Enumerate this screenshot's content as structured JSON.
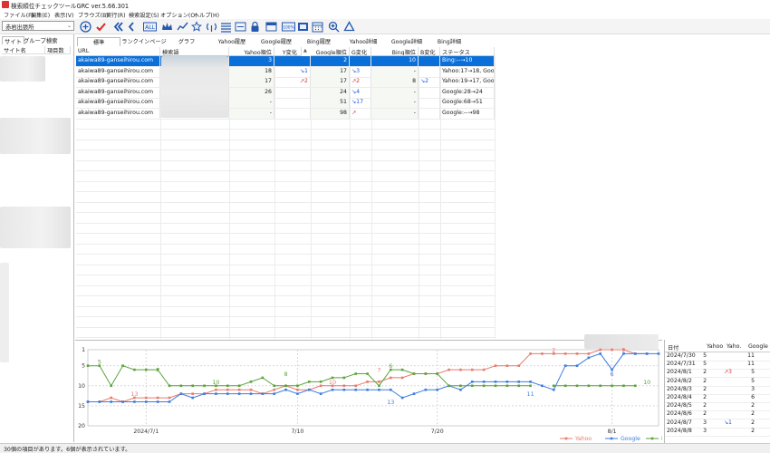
{
  "window": {
    "title": "検索順位チェックツールGRC  ver.5.66.301"
  },
  "menu": [
    "ファイル(F)",
    "編集(E)",
    "表示(V)",
    "ブラウズ(B)",
    "実行(R)",
    "検索設定(S)",
    "オプション(O)",
    "ヘルプ(H)"
  ],
  "site_select": {
    "value": "赤岩出張所"
  },
  "toolbar_icons": [
    "add-icon",
    "check-icon",
    "first-icon",
    "prev-icon",
    "all-icon",
    "crown-icon",
    "graph-icon",
    "star-icon",
    "antenna-icon",
    "list-icon",
    "export-icon",
    "lock-icon",
    "window-icon",
    "percent-icon",
    "expand-icon",
    "calendar-icon",
    "zoom-icon",
    "recycle-icon"
  ],
  "toolbar_labels": {
    "all": "ALL",
    "percent": "100%"
  },
  "left": {
    "tabs": [
      "サイト",
      "グループ",
      "検索"
    ],
    "headers": [
      "サイト名",
      "項目数"
    ]
  },
  "tabs": [
    "標準",
    "ランクインページ",
    "グラフ",
    "Yahoo履歴",
    "Google履歴",
    "Bing履歴",
    "Yahoo詳細",
    "Google詳細",
    "Bing詳細"
  ],
  "table": {
    "headers": [
      "URL",
      "検索語",
      "Yahoo順位",
      "Y変化",
      "Google順位",
      "G変化",
      "Bing順位",
      "B変化",
      "ステータス"
    ],
    "rows": [
      {
        "url": "akaiwa89-ganseihirou.com",
        "yahoo": "3",
        "ychg": "",
        "google": "2",
        "gchg": "",
        "bing": "10",
        "bchg": "",
        "status": "Bing:--→10",
        "selected": true
      },
      {
        "url": "akaiwa89-ganseihirou.com",
        "yahoo": "18",
        "ychg": "↘1",
        "google": "17",
        "gchg": "↘3",
        "bing": "-",
        "bchg": "",
        "status": "Yahoo:17→18, Goo"
      },
      {
        "url": "akaiwa89-ganseihirou.com",
        "yahoo": "17",
        "ychg": "↗2",
        "google": "17",
        "gchg": "↗2",
        "bing": "8",
        "bchg": "↘2",
        "status": "Yahoo:19→17, Goo"
      },
      {
        "url": "akaiwa89-ganseihirou.com",
        "yahoo": "26",
        "ychg": "",
        "google": "24",
        "gchg": "↘4",
        "bing": "-",
        "bchg": "",
        "status": "Google:28→24"
      },
      {
        "url": "akaiwa89-ganseihirou.com",
        "yahoo": "-",
        "ychg": "",
        "google": "51",
        "gchg": "↘17",
        "bing": "-",
        "bchg": "",
        "status": "Google:68→51"
      },
      {
        "url": "akaiwa89-ganseihirou.com",
        "yahoo": "-",
        "ychg": "",
        "google": "98",
        "gchg": "↗",
        "bing": "-",
        "bchg": "",
        "status": "Google:--→98"
      }
    ]
  },
  "chart_data": {
    "type": "line",
    "x": [
      "2024/7/1",
      "7/10",
      "7/20",
      "8/1"
    ],
    "ylim": [
      20,
      1
    ],
    "yticks": [
      1,
      5,
      10,
      15,
      20
    ],
    "series": [
      {
        "name": "Yahoo",
        "color": "#e77b6c",
        "values": [
          14,
          14,
          13,
          14,
          13,
          13,
          13,
          13,
          12,
          12,
          12,
          11,
          11,
          11,
          11,
          12,
          11,
          10,
          11,
          11,
          10,
          10,
          10,
          10,
          9,
          9,
          8,
          8,
          7,
          7,
          7,
          6,
          6,
          6,
          6,
          5,
          5,
          5,
          2,
          2,
          2,
          2,
          2,
          2,
          1,
          1,
          1,
          2,
          2
        ]
      },
      {
        "name": "Google",
        "color": "#3d7ce0",
        "values": [
          14,
          14,
          14,
          14,
          14,
          14,
          14,
          14,
          12,
          13,
          12,
          12,
          12,
          12,
          12,
          12,
          12,
          11,
          12,
          11,
          12,
          11,
          11,
          11,
          11,
          11,
          11,
          13,
          12,
          11,
          11,
          10,
          11,
          9,
          9,
          9,
          9,
          9,
          9,
          10,
          11,
          5,
          5,
          3,
          2,
          6,
          2,
          2,
          2,
          2
        ]
      },
      {
        "name": "Bing",
        "color": "#5aa33c",
        "values": [
          5,
          5,
          10,
          5,
          6,
          6,
          6,
          10,
          10,
          10,
          10,
          10,
          10,
          10,
          9,
          8,
          10,
          10,
          10,
          9,
          9,
          8,
          8,
          7,
          7,
          10,
          6,
          6,
          7,
          7,
          7,
          10,
          10,
          10,
          10,
          10,
          10,
          10,
          10,
          null,
          10,
          10,
          10,
          10,
          10,
          10,
          10,
          10
        ]
      }
    ],
    "annotations": [
      "5",
      "7",
      "13",
      "10",
      "8",
      "10",
      "7",
      "6",
      "13",
      "11",
      "2",
      "6",
      "10",
      "2"
    ]
  },
  "date_table": {
    "headers": [
      "日付",
      "Yahoo",
      "Yaho.",
      "Google"
    ],
    "rows": [
      [
        "2024/7/30",
        "5",
        "",
        "11"
      ],
      [
        "2024/7/31",
        "5",
        "",
        "11"
      ],
      [
        "2024/8/1",
        "2",
        "↗3",
        "5"
      ],
      [
        "2024/8/2",
        "2",
        "",
        "5"
      ],
      [
        "2024/8/3",
        "2",
        "",
        "3"
      ],
      [
        "2024/8/4",
        "2",
        "",
        "6"
      ],
      [
        "2024/8/5",
        "2",
        "",
        "2"
      ],
      [
        "2024/8/6",
        "2",
        "",
        "2"
      ],
      [
        "2024/8/7",
        "3",
        "↘1",
        "2"
      ],
      [
        "2024/8/8",
        "3",
        "",
        "2"
      ]
    ]
  },
  "status": "30個の項目があります。6個が表示されています。"
}
